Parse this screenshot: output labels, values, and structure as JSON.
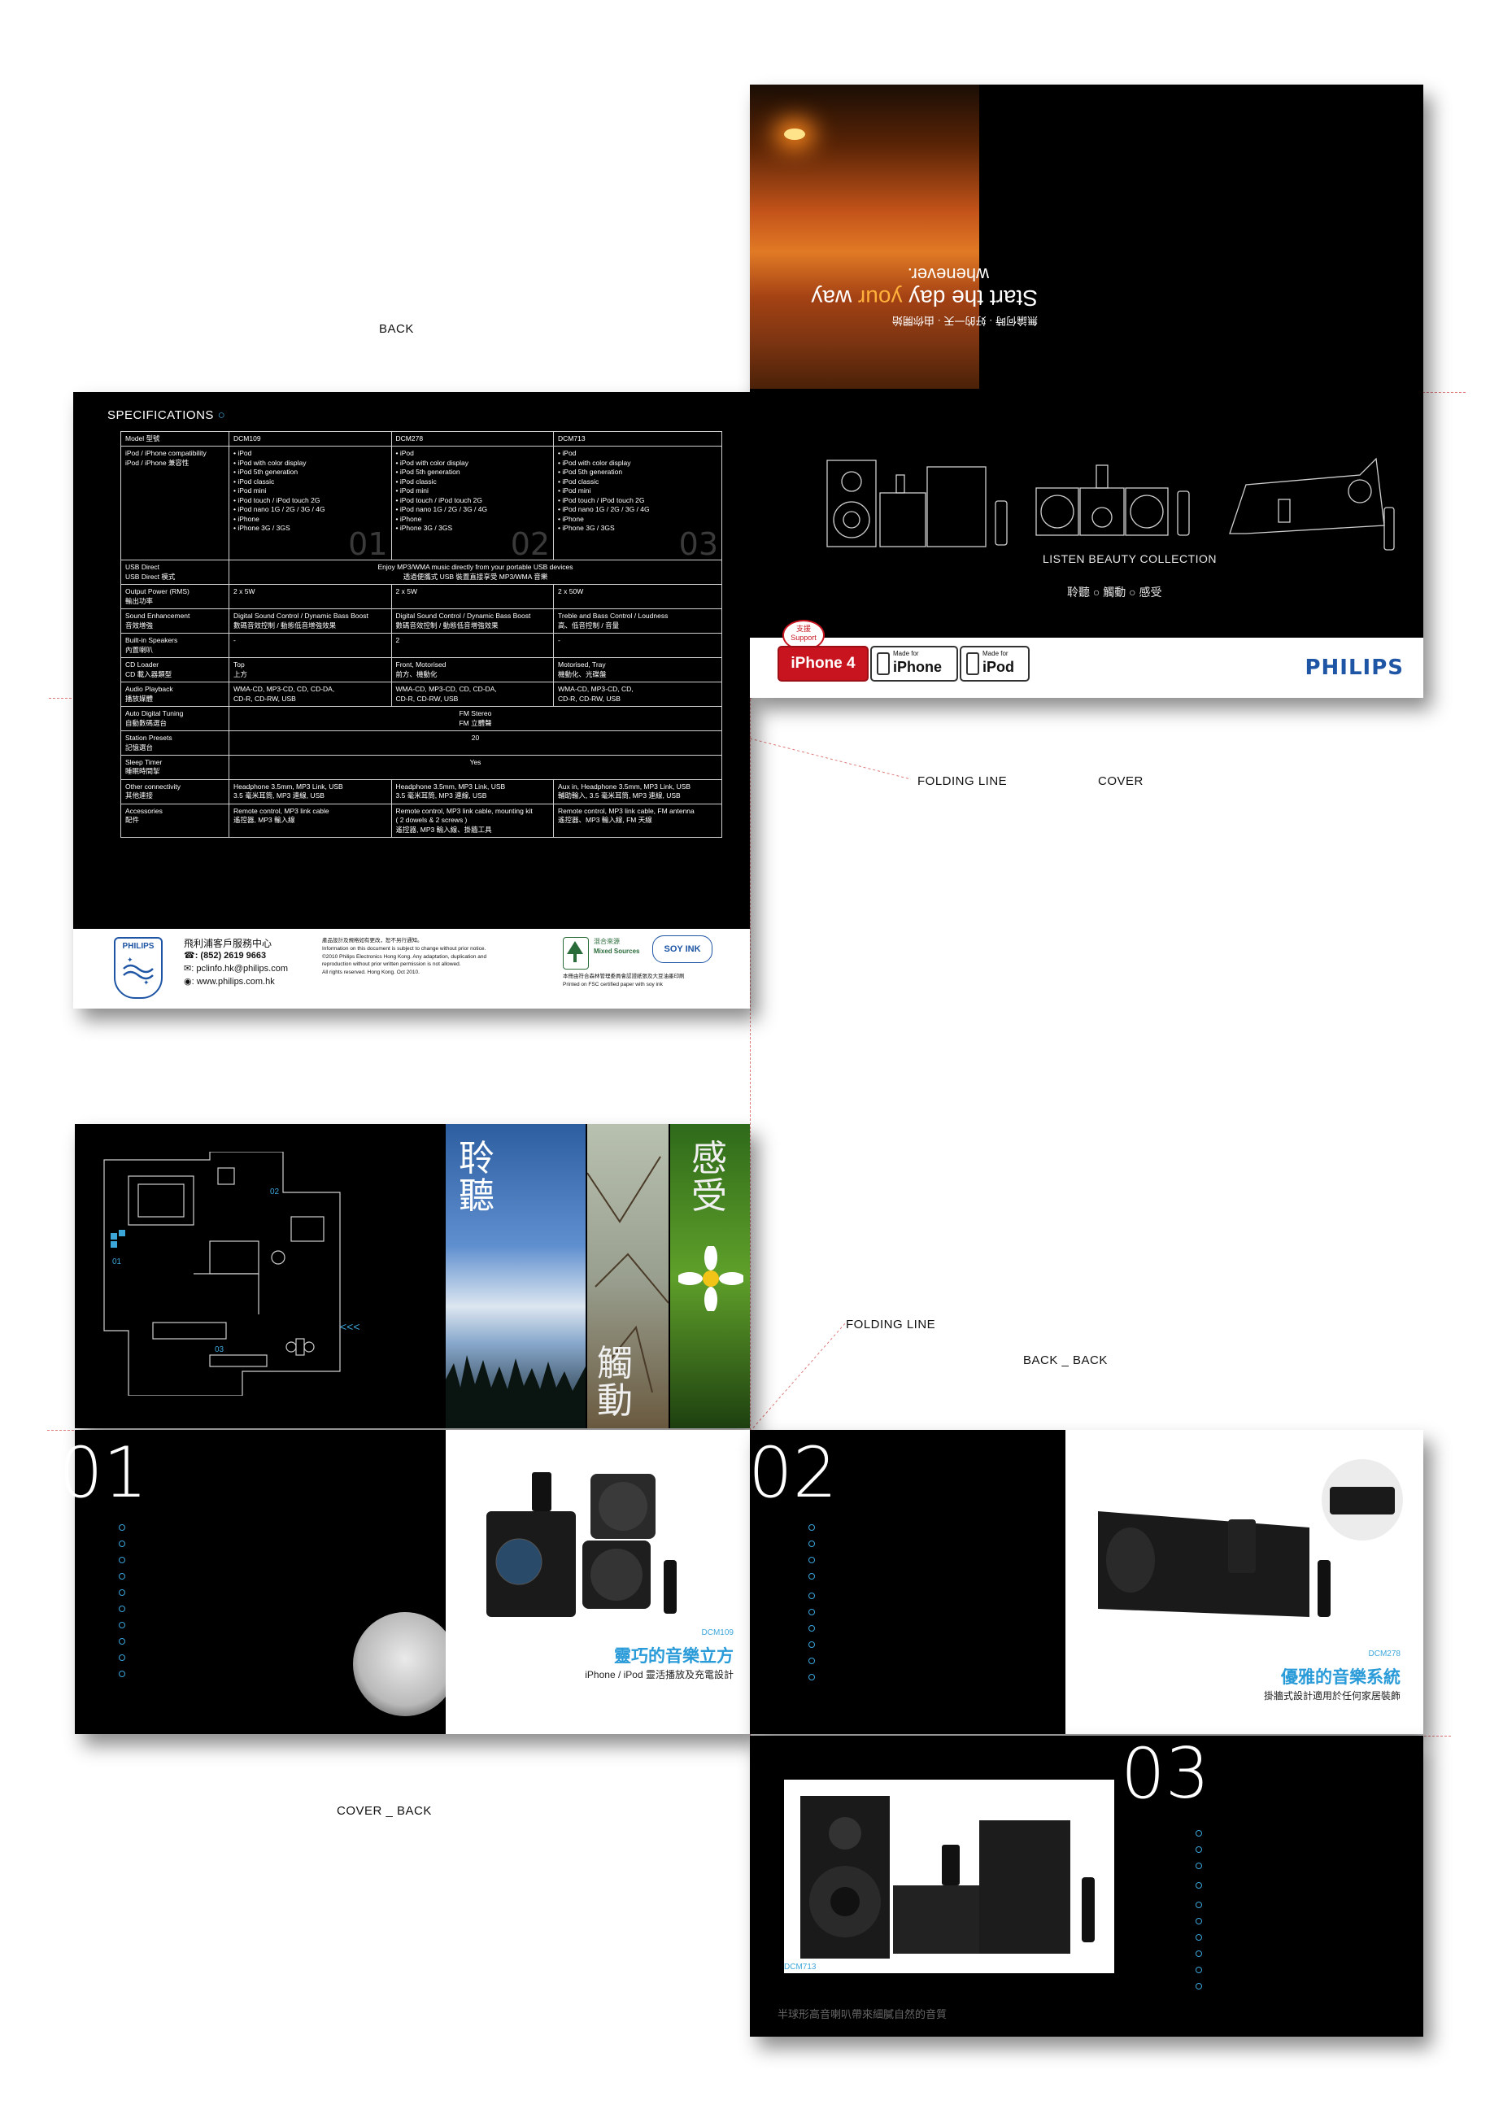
{
  "labels": {
    "back": "BACK",
    "cover": "COVER",
    "folding_line_1": "FOLDING LINE",
    "folding_line_2": "FOLDING LINE",
    "back_back": "BACK _ BACK",
    "cover_back": "COVER _ BACK"
  },
  "specs": {
    "title": "SPECIFICATIONS",
    "header": [
      "Model 型號",
      "DCM109",
      "DCM278",
      "DCM713"
    ],
    "compat_label": "iPod / iPhone compatibility\niPod / iPhone 兼容性",
    "compat": [
      [
        "• iPod",
        "• iPod with color display",
        "• iPod 5th generation",
        "• iPod classic",
        "• iPod mini",
        "• iPod touch / iPod touch 2G",
        "• iPod nano 1G / 2G / 3G / 4G",
        "• iPhone",
        "• iPhone 3G / 3GS"
      ],
      [
        "• iPod",
        "• iPod with color display",
        "• iPod 5th generation",
        "• iPod classic",
        "• iPod mini",
        "• iPod touch / iPod touch 2G",
        "• iPod nano 1G / 2G / 3G / 4G",
        "• iPhone",
        "• iPhone 3G / 3GS"
      ],
      [
        "• iPod",
        "• iPod with color display",
        "• iPod 5th generation",
        "• iPod classic",
        "• iPod mini",
        "• iPod touch / iPod touch 2G",
        "• iPod nano 1G / 2G / 3G / 4G",
        "• iPhone",
        "• iPhone 3G / 3GS"
      ]
    ],
    "nums": [
      "01",
      "02",
      "03"
    ],
    "usb_label": "USB Direct\nUSB Direct 模式",
    "usb_value": "Enjoy MP3/WMA music directly from your portable USB devices\n透過便攜式 USB 裝置直接享受 MP3/WMA 音樂",
    "output_label": "Output Power (RMS)\n輸出功率",
    "output": [
      "2 x 5W",
      "2 x 5W",
      "2 x 50W"
    ],
    "sound_label": "Sound Enhancement\n音效增強",
    "sound": [
      "Digital Sound Control / Dynamic Bass Boost\n數碼音效控制 / 動態低音增強效果",
      "Digital Sound Control / Dynamic Bass Boost\n數碼音效控制 / 動態低音增強效果",
      "Treble and Bass Control / Loudness\n高、低音控制 / 音量"
    ],
    "speakers_label": "Built-in Speakers\n內置喇叭",
    "speakers": [
      "-",
      "2",
      "-"
    ],
    "cd_label": "CD Loader\nCD 載入器類型",
    "cd": [
      "Top\n上方",
      "Front, Motorised\n前方、機動化",
      "Motorised, Tray\n機動化、光碟盤"
    ],
    "audio_label": "Audio Playback\n播放媒體",
    "audio": [
      "WMA-CD, MP3-CD, CD, CD-DA,\nCD-R, CD-RW, USB",
      "WMA-CD, MP3-CD, CD, CD-DA,\nCD-R, CD-RW, USB",
      "WMA-CD, MP3-CD, CD,\nCD-R, CD-RW, USB"
    ],
    "tuning_label": "Auto Digital Tuning\n自動數碼選台",
    "tuning_value": "FM Stereo\nFM 立體聲",
    "presets_label": "Station Presets\n記憶選台",
    "presets_value": "20",
    "sleep_label": "Sleep Timer\n睡眠時間掣",
    "sleep_value": "Yes",
    "conn_label": "Other connectivity\n其他連接",
    "conn": [
      "Headphone 3.5mm, MP3 Link, USB\n3.5 毫米耳筒, MP3 連線, USB",
      "Headphone 3.5mm, MP3 Link, USB\n3.5 毫米耳筒, MP3 連線, USB",
      "Aux in, Headphone 3.5mm, MP3 Link, USB\n輔助輸入, 3.5 毫米耳筒, MP3 連線, USB"
    ],
    "acc_label": "Accessories\n配件",
    "acc": [
      "Remote control, MP3 link cable\n遙控器, MP3 輸入線",
      "Remote control, MP3 link cable, mounting kit\n( 2 dowels & 2 screws )\n遙控器, MP3 輸入線、掛牆工具",
      "Remote control, MP3 link cable, FM antenna\n遙控器、MP3 輸入線, FM 天線"
    ]
  },
  "back_footer": {
    "logo_text": "PHILIPS",
    "service_title": "飛利浦客戶服務中心",
    "phone": ": (852) 2619 9663",
    "email": ": pclinfo.hk@philips.com",
    "web": ": www.philips.com.hk",
    "legal": "產品設計及規格如有更改，恕不另行通知。\nInformation on this document is subject to change without prior notice.\n©2010 Philips Electronics Hong Kong. Any adaptation, duplication and\nreproduction without prior written permission is not allowed.\nAll rights reserved. Hong Kong. Oct 2010.",
    "fsc_top": "混合來源",
    "fsc_name": "Mixed Sources",
    "soy_ink": "SOY INK",
    "print_note": "本冊由符合森林管理委員會認證紙張及大豆油墨印刷\nPrinted on FSC certified paper with soy ink"
  },
  "cover": {
    "tagline_1": "Start the day ",
    "tagline_your": "your",
    "tagline_2": " way",
    "tagline_3": "whenever.",
    "tagline_cn": "無論何時 · 好的一天 · 由你開始",
    "collection": "LISTEN BEAUTY COLLECTION",
    "collection_cn": "聆聽 ○ 觸動 ○ 感受",
    "support_1": "支援",
    "support_2": "Support",
    "badge_iphone4": "iPhone 4",
    "made_for": "Made for",
    "badge_iphone": "iPhone",
    "badge_ipod": "iPod",
    "philips": "PHILIPS"
  },
  "inner": {
    "floor_labels": [
      "01",
      "02",
      "03"
    ],
    "arrows": "<<<",
    "listen": "聆聽",
    "touch": "觸動",
    "feel": "感受",
    "p1_num": "01",
    "p1_model": "DCM109",
    "p1_headline": "靈巧的音樂立方",
    "p1_sub": "iPhone / iPod 靈活播放及充電設計",
    "p2_num": "02",
    "p2_model": "DCM278",
    "p2_headline": "優雅的音樂系統",
    "p2_sub": "掛牆式設計適用於任何家居裝飾",
    "p3_num": "03",
    "p3_model": "DCM713",
    "p3_sub": "半球形高音喇叭帶來細膩自然的音質"
  },
  "colors": {
    "accent": "#2a9bd9",
    "brand": "#1e55a4",
    "fold": "#e07a7a"
  }
}
